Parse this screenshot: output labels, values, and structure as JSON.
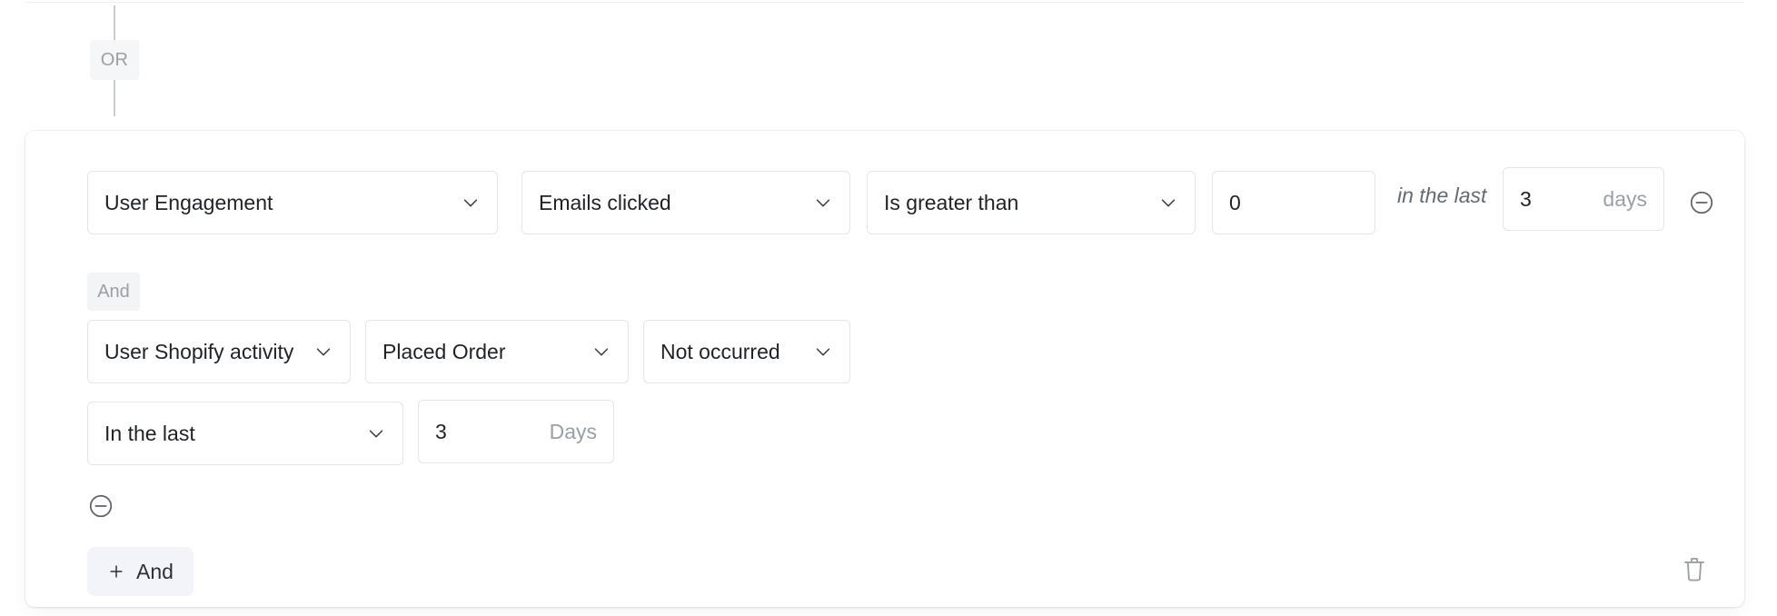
{
  "connector": {
    "or_label": "OR"
  },
  "group": {
    "and_badge_label": "And",
    "add_and_label": "And",
    "add_and_icon": "plus-icon",
    "delete_group_icon": "trash-icon",
    "remove_icon": "circle-minus-icon",
    "chevron_icon": "chevron-down-icon"
  },
  "conditions": [
    {
      "category": "User Engagement",
      "attribute": "Emails clicked",
      "operator": "Is greater than",
      "value": "0",
      "timeframe_text": "in the last",
      "timeframe_value": "3",
      "timeframe_unit": "days"
    },
    {
      "category": "User Shopify activity",
      "attribute": "Placed Order",
      "operator": "Not occurred",
      "timeframe_mode": "In the last",
      "timeframe_value": "3",
      "timeframe_unit": "Days"
    }
  ],
  "colors": {
    "badge_bg": "#f5f6f7",
    "badge_text": "#9aa0a6",
    "control_border": "#e3e5e8",
    "text": "#1f2328",
    "muted_text": "#9aa0a6",
    "add_button_bg": "#f3f4fa",
    "connector_line": "#c9ccd1"
  }
}
